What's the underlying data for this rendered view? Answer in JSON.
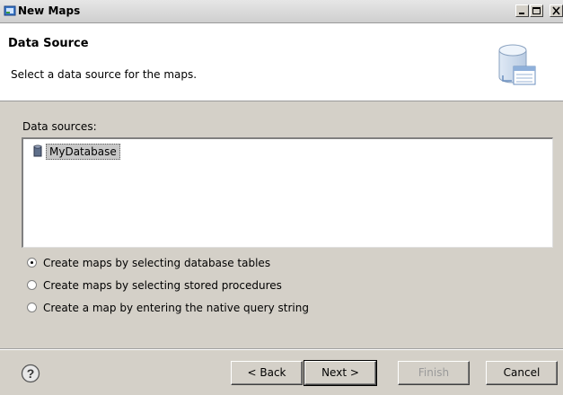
{
  "window": {
    "title": "New Maps"
  },
  "header": {
    "title": "Data Source",
    "description": "Select a data source for the maps."
  },
  "data_sources": {
    "label": "Data sources:",
    "items": [
      "MyDatabase"
    ],
    "selected": "MyDatabase"
  },
  "options": [
    {
      "label": "Create maps by selecting database tables",
      "checked": true
    },
    {
      "label": "Create maps by selecting stored procedures",
      "checked": false
    },
    {
      "label": "Create a map by entering the native query string",
      "checked": false
    }
  ],
  "buttons": {
    "back": "< Back",
    "next": "Next >",
    "finish": "Finish",
    "cancel": "Cancel",
    "help": "?"
  }
}
